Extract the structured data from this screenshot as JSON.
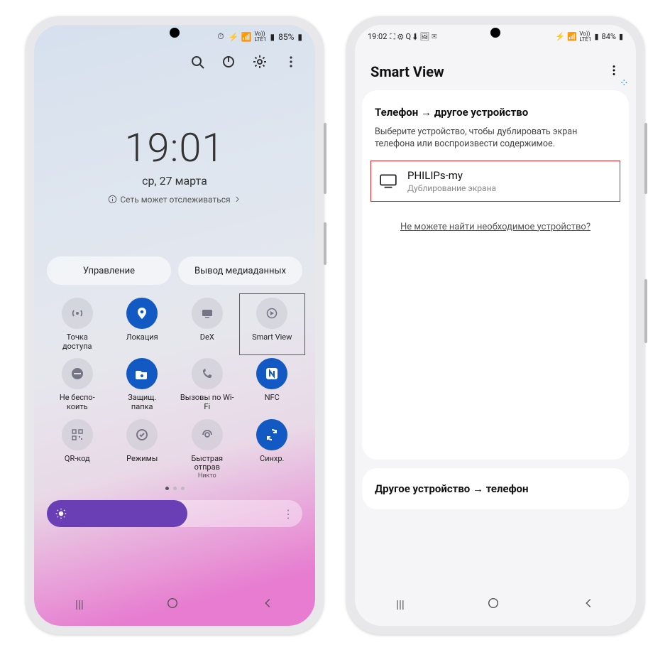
{
  "phone1": {
    "status": {
      "battery": "85%",
      "net": "Vo))\nLTE1"
    },
    "clock": {
      "time": "19:01",
      "date": "ср, 27 марта",
      "network": "Сеть может отслеживаться"
    },
    "pills": {
      "left": "Управление",
      "right": "Вывод медиаданных"
    },
    "tiles": [
      {
        "id": "hotspot",
        "label": "Точка\nдоступа",
        "on": false,
        "icon": "wifi-hotspot"
      },
      {
        "id": "location",
        "label": "Локация",
        "on": true,
        "icon": "location"
      },
      {
        "id": "dex",
        "label": "DeX",
        "on": false,
        "icon": "dex"
      },
      {
        "id": "smartview",
        "label": "Smart View",
        "on": false,
        "icon": "smart-view",
        "highlight": true
      },
      {
        "id": "dnd",
        "label": "Не беспо-\nкоить",
        "on": false,
        "icon": "dnd"
      },
      {
        "id": "secure",
        "label": "Защищ.\nпапка",
        "on": true,
        "icon": "secure-folder"
      },
      {
        "id": "wificall",
        "label": "Вызовы по Wi-Fi",
        "on": false,
        "icon": "wifi-call"
      },
      {
        "id": "nfc",
        "label": "NFC",
        "on": true,
        "icon": "nfc"
      },
      {
        "id": "qr",
        "label": "QR-код",
        "on": false,
        "icon": "qr"
      },
      {
        "id": "modes",
        "label": "Режимы",
        "on": false,
        "icon": "modes"
      },
      {
        "id": "nearby",
        "label": "Быстрая отправ",
        "sub": "Никто",
        "on": false,
        "icon": "nearby"
      },
      {
        "id": "sync",
        "label": "Синхр.",
        "on": true,
        "icon": "sync"
      }
    ]
  },
  "phone2": {
    "status": {
      "time": "19:02",
      "battery": "84%",
      "net": "Vo))\nLTE1"
    },
    "title": "Smart View",
    "section_title": "Телефон → другое устройство",
    "hint": "Выберите устройство, чтобы дублировать экран телефона или воспроизвести содержимое.",
    "device": {
      "name": "PHILIPs-my",
      "sub": "Дублирование экрана"
    },
    "help_link": "Не можете найти необходимое устройство?",
    "footer_title": "Другое устройство → телефон"
  }
}
